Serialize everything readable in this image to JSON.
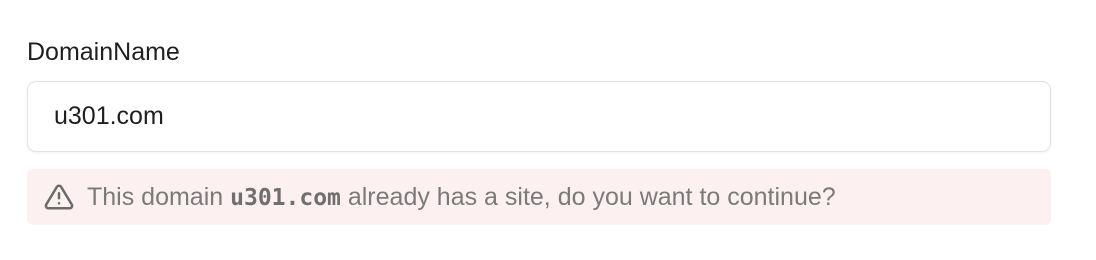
{
  "field": {
    "label": "DomainName",
    "value": "u301.com",
    "placeholder": ""
  },
  "warning": {
    "icon": "alert-triangle-icon",
    "text_before": "This domain ",
    "domain": "u301.com",
    "text_after": " already has a site, do you want to continue?",
    "background_color": "#fdf0f0",
    "text_color": "#7a7a7a"
  }
}
